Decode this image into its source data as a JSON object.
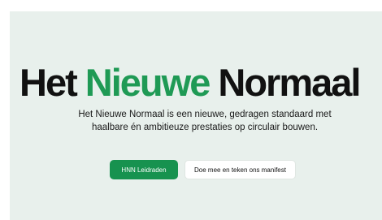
{
  "hero": {
    "title_part1": "Het ",
    "title_accent": "Nieuwe",
    "title_part2": " Normaal",
    "description": "Het Nieuwe Normaal is een nieuwe, gedragen standaard met haalbare én ambitieuze prestaties op circulair bouwen.",
    "primary_button_label": "HNN Leidraden",
    "secondary_button_label": "Doe mee en teken ons manifest"
  },
  "colors": {
    "accent": "#1f9a55",
    "primary_button": "#17924f",
    "hero_background": "#e8f0ec",
    "title_text": "#111111"
  }
}
